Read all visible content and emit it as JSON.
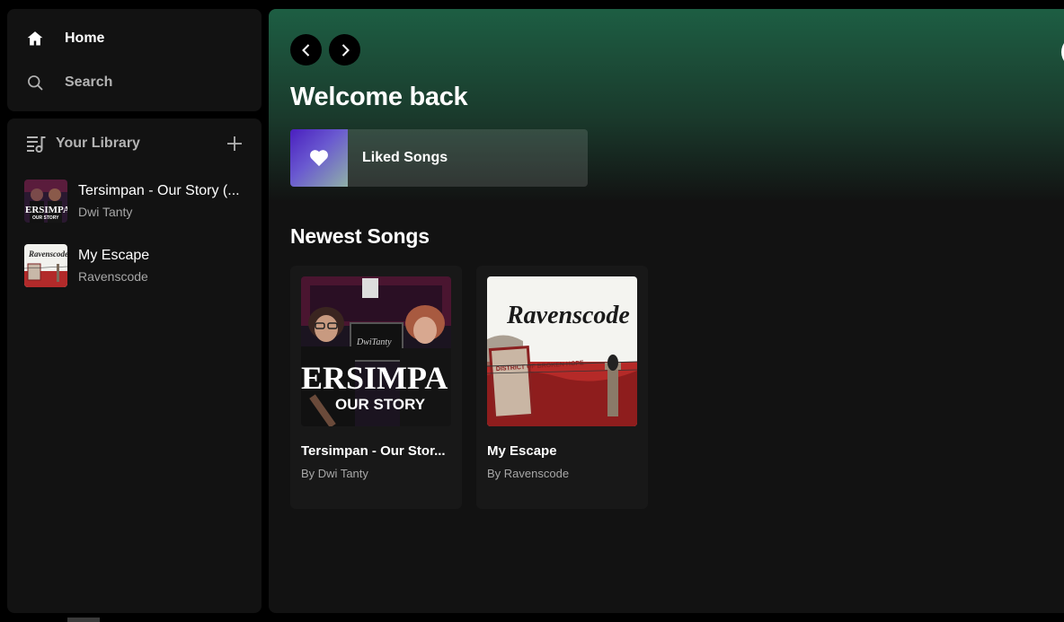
{
  "sidebar": {
    "nav": {
      "home_label": "Home",
      "search_label": "Search"
    },
    "library": {
      "title": "Your Library",
      "items": [
        {
          "title": "Tersimpan - Our Story (...",
          "subtitle": "Dwi Tanty",
          "art": "tersimpan-cover"
        },
        {
          "title": "My Escape",
          "subtitle": "Ravenscode",
          "art": "ravenscode-cover"
        }
      ]
    }
  },
  "main": {
    "greeting": "Welcome back",
    "liked_songs_label": "Liked Songs",
    "newest_section_title": "Newest Songs",
    "cards": [
      {
        "title": "Tersimpan - Our Stor...",
        "subtitle": "By Dwi Tanty",
        "art": "tersimpan-cover"
      },
      {
        "title": "My Escape",
        "subtitle": "By Ravenscode",
        "art": "ravenscode-cover"
      }
    ]
  },
  "art_text": {
    "tersimpan_main": "ERSIMPA",
    "tersimpan_sub": "OUR STORY",
    "ravenscode_logo": "Ravenscode",
    "ravenscode_sign": "DISTRICT OF BROKEN HOPE"
  },
  "colors": {
    "accent_green": "#1d5e43",
    "panel_bg": "#121212",
    "card_bg": "#181818",
    "muted_text": "#a7a7a7"
  },
  "icons": [
    "home-icon",
    "search-icon",
    "library-icon",
    "plus-icon",
    "chevron-left-icon",
    "chevron-right-icon",
    "heart-icon"
  ]
}
